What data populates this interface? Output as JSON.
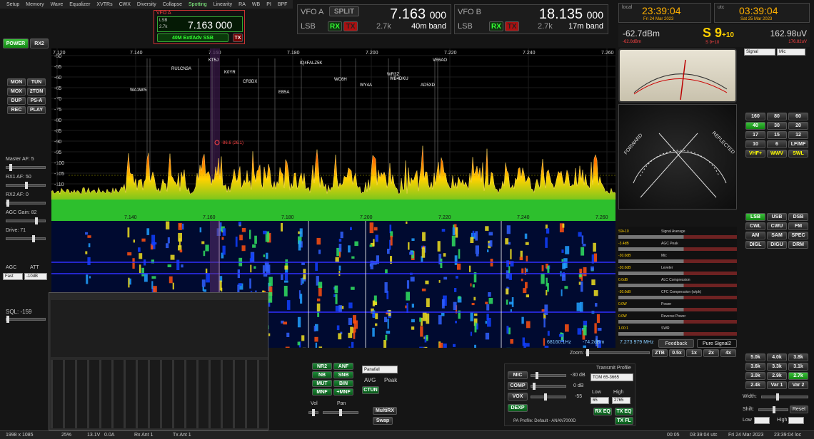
{
  "menu": [
    "Setup",
    "Memory",
    "Wave",
    "Equalizer",
    "XVTRs",
    "CWX",
    "Diversity",
    "Collapse",
    "Spotting",
    "Linearity",
    "RA",
    "WB",
    "PI",
    "BPF"
  ],
  "vfo_a_mini": {
    "label": "VFO A",
    "mode": "LSB",
    "step": "2.7k",
    "freq": "7.163 000",
    "band": "40M Ext/Adv SSB",
    "tx": "TX"
  },
  "vfo_a": {
    "label": "VFO A",
    "split": "SPLIT",
    "freq_main": "7.163",
    "freq_sub": "000",
    "mode": "LSB",
    "rx": "RX",
    "tx": "TX",
    "bw": "2.7k",
    "band": "40m band"
  },
  "vfo_b": {
    "label": "VFO B",
    "freq_main": "18.135",
    "freq_sub": "000",
    "mode": "LSB",
    "rx": "RX",
    "tx": "TX",
    "bw": "2.7k",
    "band": "17m band"
  },
  "clock": {
    "local_label": "local",
    "local_time": "23:39:04",
    "local_date": "Fri 24 Mar 2023",
    "utc_label": "utc",
    "utc_time": "03:39:04",
    "utc_date": "Sat 25 Mar 2023"
  },
  "signal": {
    "dbm": "-62.7dBm",
    "dbm2": "-62.0dBm",
    "s": "S 9",
    "s_plus": "+10",
    "s2": "S 9",
    "s2_plus": "+10",
    "uv": "162.98uV",
    "uv2": "176.82uV",
    "sel1": "Signal",
    "sel2": "Mic"
  },
  "left": {
    "power": "POWER",
    "rx2": "RX2",
    "buttons": [
      "MON",
      "TUN",
      "MOX",
      "2TON",
      "DUP",
      "PS-A",
      "REC",
      "PLAY"
    ],
    "master_af": "Master AF:  5",
    "rx1_af": "RX1 AF:  50",
    "rx2_af": "RX2 AF:  0",
    "agc_gain": "AGC Gain:  82",
    "drive": "Drive:  71",
    "agc": "AGC",
    "att": "ATT",
    "agc_val": "Fast",
    "att_val": "-10dB",
    "sql": "SQL:  -159"
  },
  "pan": {
    "freqs": [
      "7.120",
      "7.140",
      "7.160",
      "7.180",
      "7.200",
      "7.220",
      "7.240",
      "7.260"
    ],
    "db": [
      "-50",
      "-55",
      "-60",
      "-65",
      "-70",
      "-75",
      "-80",
      "-85",
      "-90",
      "-95",
      "-100",
      "-105",
      "-110",
      "-115"
    ],
    "marker": "-86.6 (26.1)",
    "calls": [
      "WA1W/5",
      "RU1CN3A",
      "KT5J",
      "K0YR",
      "CR3DX",
      "EB5A",
      "IQ4FALZ5K",
      "WC6H",
      "WY4A",
      "WR3Z",
      "WB4DKU",
      "AD5XD",
      "VE6AO"
    ]
  },
  "wf": {
    "freqs": [
      "7.140",
      "7.160",
      "7.180",
      "7.200",
      "7.220",
      "7.240",
      "7.260"
    ],
    "readout_hz": "68160.1Hz",
    "readout_dbm": "-74.2dBm",
    "readout_mhz": "7.273 979 MHz"
  },
  "zoom": {
    "label": "Zoom:",
    "ztb": "ZTB",
    "btns": [
      "0.5x",
      "1x",
      "2x",
      "4x"
    ]
  },
  "bands": [
    "160",
    "80",
    "60",
    "40",
    "30",
    "20",
    "17",
    "15",
    "12",
    "10",
    "6",
    "LF/MF",
    "VHF+",
    "WWV",
    "SWL"
  ],
  "modes": [
    "LSB",
    "USB",
    "DSB",
    "CWL",
    "CWU",
    "FM",
    "AM",
    "SAM",
    "SPEC",
    "DIGL",
    "DIGU",
    "DRM"
  ],
  "meters": [
    {
      "name": "Signal Average",
      "left": "S9+10",
      "right": "S9+10"
    },
    {
      "name": "AGC Peak",
      "left": "-3.4dB",
      "right": ""
    },
    {
      "name": "Mic",
      "left": "-30.0dB",
      "right": ""
    },
    {
      "name": "Leveler",
      "left": "-30.0dB",
      "right": ""
    },
    {
      "name": "ALC Compression",
      "left": "0.0dB",
      "right": ""
    },
    {
      "name": "CFC Compression (w/pk)",
      "left": "-30.0dB",
      "right": ""
    },
    {
      "name": "Power",
      "left": "0.0W",
      "right": ""
    },
    {
      "name": "Reverse Power",
      "left": "0.0W",
      "right": ""
    },
    {
      "name": "SWR",
      "left": "1.00:1",
      "right": ""
    }
  ],
  "feedback": {
    "tab1": "Feedback",
    "tab2": "Pure Signal2"
  },
  "filters": [
    "5.0k",
    "4.0k",
    "3.8k",
    "3.6k",
    "3.3k",
    "3.1k",
    "3.0k",
    "2.9k",
    "2.7k",
    "2.4k",
    "Var 1",
    "Var 2"
  ],
  "filter_labels": {
    "width": "Width:",
    "shift": "Shift:",
    "reset": "Reset",
    "low": "Low",
    "high": "High"
  },
  "dsp": {
    "btns": [
      "NR2",
      "ANF",
      "NB",
      "SNB",
      "MUT",
      "BIN",
      "MNF",
      "+MNF"
    ],
    "display": "Panafall",
    "avg": "AVG",
    "peak": "Peak",
    "ctun": "CTUN",
    "vol": "Vol",
    "pan": "Pan",
    "multirx": "MultiRX",
    "swap": "Swap"
  },
  "tx": {
    "mic": "MIC",
    "comp": "COMP",
    "vox": "VOX",
    "dexp": "DEXP",
    "mic_val": "-30 dB",
    "comp_val": "0 dB",
    "vox_val": "-55",
    "profile_label": "Transmit Profile",
    "profile": "TOM 65-3665",
    "low": "Low",
    "high": "High",
    "low_val": "65",
    "high_val": "2765",
    "rxeq": "RX EQ",
    "txeq": "TX EQ",
    "txfl": "TX FL",
    "pa": "PA Profile: Default - ANAN7000D"
  },
  "status": {
    "res": "1998 x 1085",
    "cpu": "25%",
    "volt": "13.1V",
    "amp": "0.0A",
    "rx_ant": "Rx Ant 1",
    "tx_ant": "Tx Ant 1",
    "timer": "00:05",
    "time": "03:39:04 utc",
    "date": "Fri 24 Mar 2023",
    "time2": "23:39:04 loc"
  },
  "colors": {
    "green": "#2dbf2d",
    "amber": "#ffb000",
    "bg": "#151515",
    "spectrum_low": "#ffd200",
    "spectrum_high": "#ff2000"
  }
}
